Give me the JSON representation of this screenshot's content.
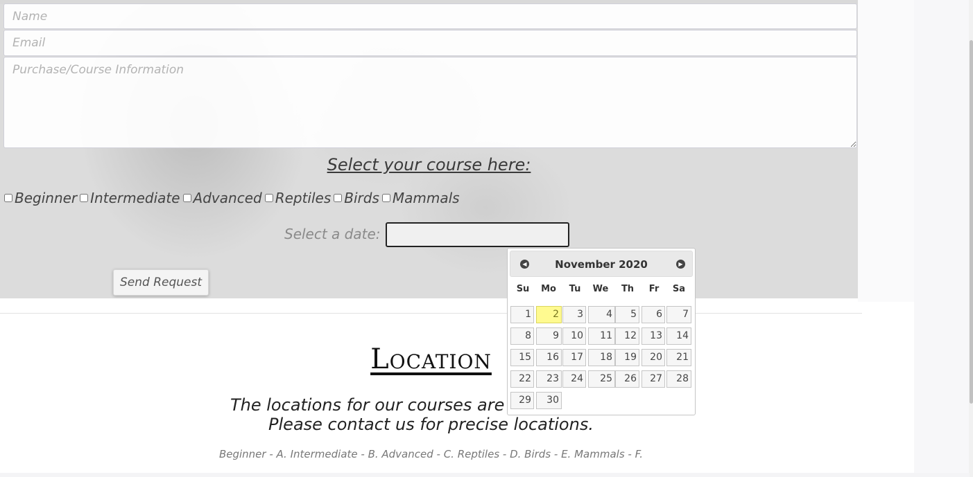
{
  "form": {
    "name_placeholder": "Name",
    "email_placeholder": "Email",
    "info_placeholder": "Purchase/Course Information",
    "course_heading": "Select your course here:",
    "courses": [
      "Beginner",
      "Intermediate",
      "Advanced",
      "Reptiles",
      "Birds",
      "Mammals"
    ],
    "date_label": "Select a date:",
    "date_value": "",
    "send_label": "Send Request"
  },
  "datepicker": {
    "month_year": "November 2020",
    "prev_icon": "chevron-left-circle-icon",
    "next_icon": "chevron-right-circle-icon",
    "weekdays": [
      "Su",
      "Mo",
      "Tu",
      "We",
      "Th",
      "Fr",
      "Sa"
    ],
    "weeks": [
      [
        "1",
        "2",
        "3",
        "4",
        "5",
        "6",
        "7"
      ],
      [
        "8",
        "9",
        "10",
        "11",
        "12",
        "13",
        "14"
      ],
      [
        "15",
        "16",
        "17",
        "18",
        "19",
        "20",
        "21"
      ],
      [
        "22",
        "23",
        "24",
        "25",
        "26",
        "27",
        "28"
      ],
      [
        "29",
        "30"
      ]
    ],
    "highlighted_day": "2",
    "highlight_color": "#fffa90"
  },
  "location": {
    "title": "Location",
    "line1": "The locations for our courses are",
    "line2": "Please contact us for precise locations.",
    "legend": "Beginner - A. Intermediate - B. Advanced - C. Reptiles - D. Birds - E. Mammals - F."
  }
}
